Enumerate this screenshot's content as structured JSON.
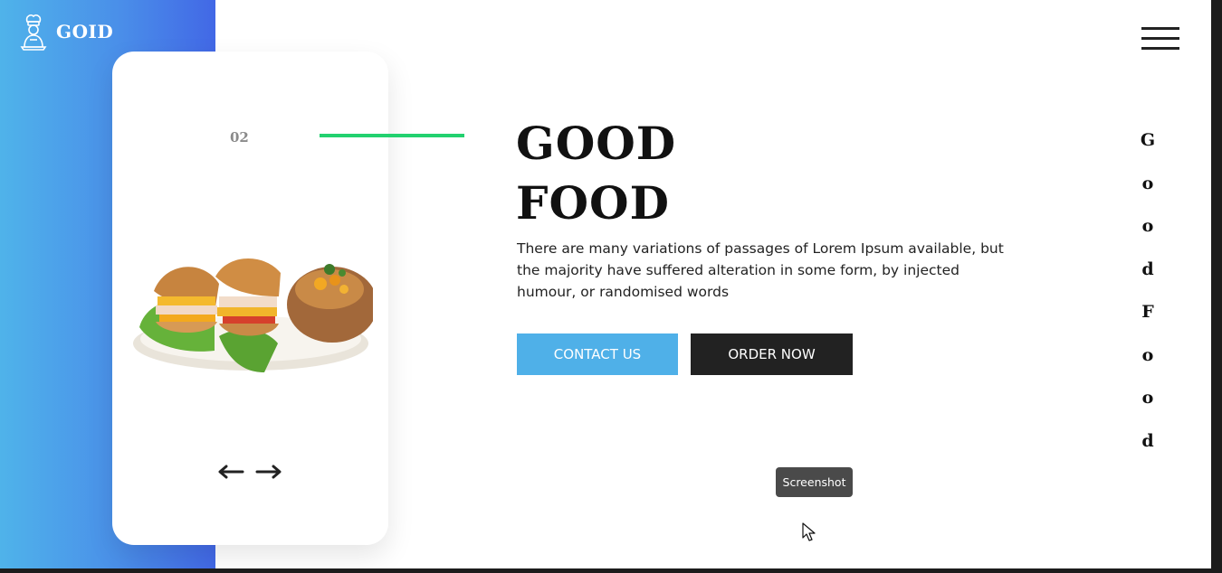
{
  "brand": {
    "name": "GOID",
    "icon": "chef-icon"
  },
  "menu": {
    "icon": "hamburger-menu-icon"
  },
  "slider": {
    "slide_number": "02",
    "prev_icon": "arrow-left-icon",
    "next_icon": "arrow-right-icon",
    "image": "sandwich-plate-image"
  },
  "hero": {
    "title_line1": "GOOD",
    "title_line2": "FOOD",
    "description": "There are many variations of passages of Lorem Ipsum available, but the majority have suffered alteration in some form, by injected humour, or randomised words",
    "contact_label": "CONTACT US",
    "order_label": "ORDER NOW"
  },
  "vertical_letters": [
    "G",
    "o",
    "o",
    "d",
    "F",
    "o",
    "o",
    "d"
  ],
  "tooltip": {
    "text": "Screenshot"
  },
  "colors": {
    "accent_blue": "#4fb0e8",
    "gradient_end": "#4268e6",
    "accent_green": "#22d16f",
    "dark": "#222222"
  }
}
